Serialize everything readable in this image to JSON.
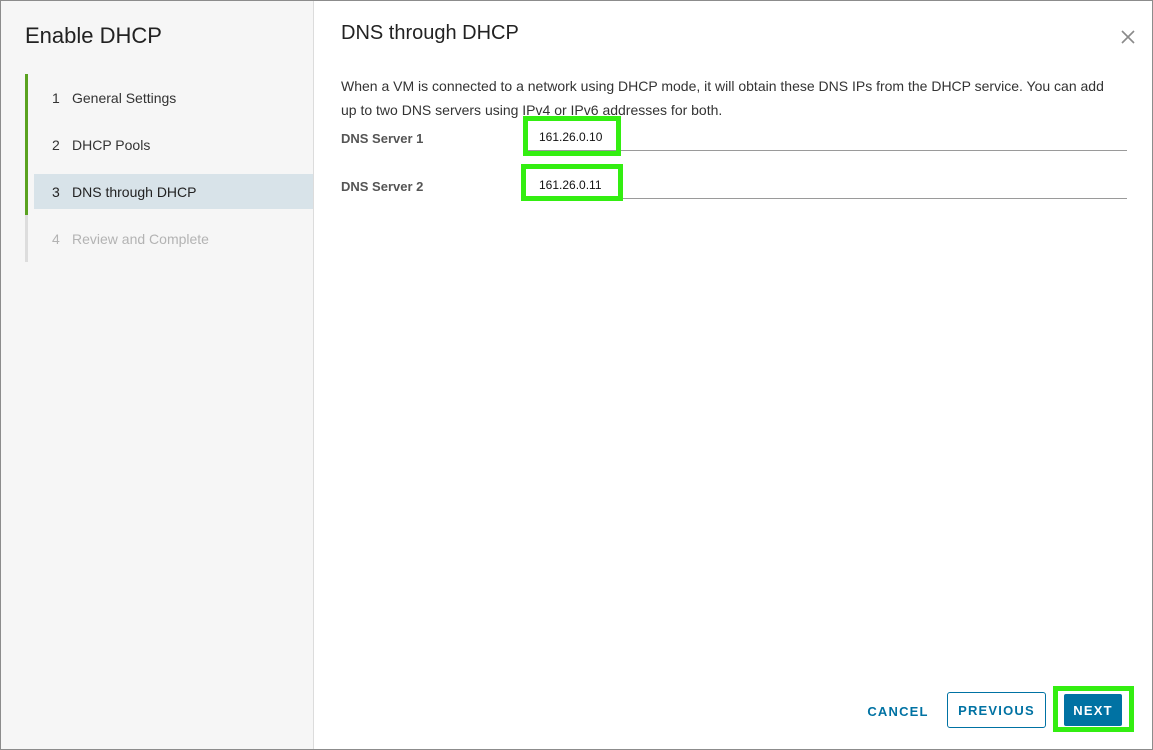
{
  "wizard": {
    "title": "Enable DHCP",
    "steps": [
      {
        "num": "1",
        "label": "General Settings",
        "state": "completed"
      },
      {
        "num": "2",
        "label": "DHCP Pools",
        "state": "completed"
      },
      {
        "num": "3",
        "label": "DNS through DHCP",
        "state": "current"
      },
      {
        "num": "4",
        "label": "Review and Complete",
        "state": "disabled"
      }
    ]
  },
  "page": {
    "title": "DNS through DHCP",
    "description": "When a VM is connected to a network using DHCP mode, it will obtain these DNS IPs from the DHCP service. You can add up to two DNS servers using IPv4 or IPv6 addresses for both.",
    "fields": {
      "dns1": {
        "label": "DNS Server 1",
        "value": "161.26.0.10"
      },
      "dns2": {
        "label": "DNS Server 2",
        "value": "161.26.0.11"
      }
    }
  },
  "footer": {
    "cancel_label": "CANCEL",
    "previous_label": "PREVIOUS",
    "next_label": "NEXT"
  },
  "colors": {
    "accent": "#0072a3",
    "progress": "#5aa220",
    "highlight": "#33ee11",
    "current_step_bg": "#d8e3e9"
  },
  "icons": {
    "close": "close-icon"
  }
}
